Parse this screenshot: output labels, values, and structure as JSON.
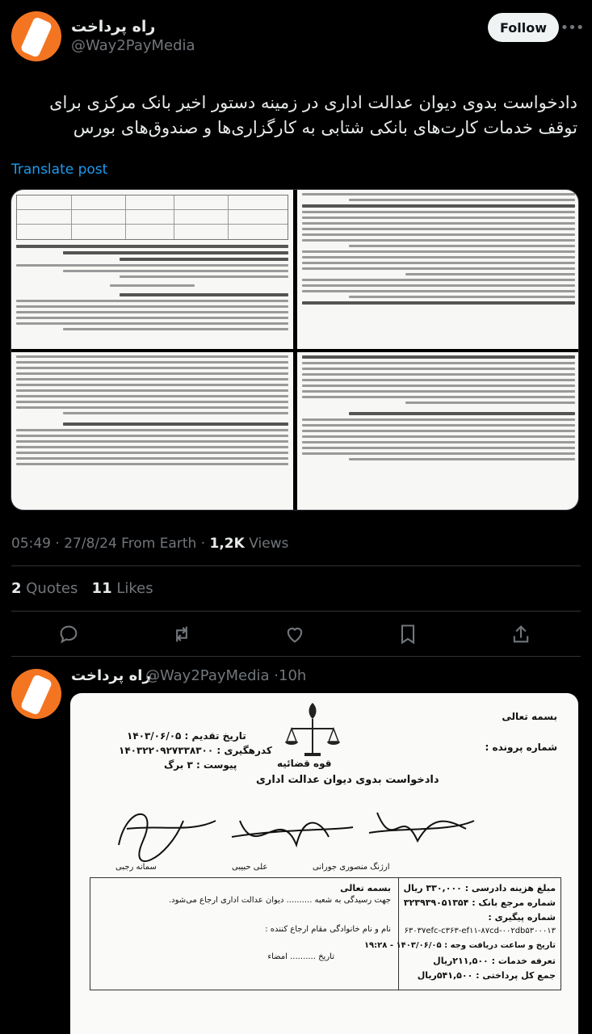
{
  "post": {
    "author_name": "راه پرداخت",
    "author_handle": "@Way2PayMedia",
    "follow_label": "Follow",
    "text": "دادخواست بدوی دیوان عدالت اداری در زمینه دستور اخیر بانک مرکزی برای توقف خدمات کارت‌های بانکی شتابی به کارگزاری‌ها و صندوق‌های بورس",
    "translate_label": "Translate post",
    "time": "05:49",
    "date": "27/8/24",
    "source": "From Earth",
    "views_count": "1,2K",
    "views_label": "Views",
    "quotes_count": "2",
    "quotes_label": "Quotes",
    "likes_count": "11",
    "likes_label": "Likes",
    "actions": [
      "reply-icon",
      "retweet-icon",
      "like-icon",
      "bookmark-icon",
      "share-icon"
    ]
  },
  "reply": {
    "author_name": "راه پرداخت",
    "author_handle": "@Way2PayMedia",
    "time_ago": "10h",
    "doc": {
      "basmala": "بسمه تعالی",
      "case_number_label": "شماره پرونده :",
      "submit_date": "تاریخ تقدیم : ۱۴۰۳/۰۶/۰۵",
      "tracking_code": "کدرهگیری : ۱۴۰۳۲۲۰۹۲۷۳۳۸۳۰۰",
      "attachment": "پیوست : ۳ برگ",
      "judiciary": "قوه قضائیه",
      "title": "دادخواست بدوی دیوان عدالت اداری",
      "signers": [
        "ارژنگ منصوری جورانی",
        "علی حبیبی",
        "سمانه رجبی"
      ],
      "fee_lines": [
        "مبلغ هزینه دادرسی : ۳۳۰,۰۰۰ ریال",
        "شماره مرجع بانک : ۳۲۳۹۳۹۰۵۱۳۵۴",
        "شماره پیگیری :",
        "۶۳۰۳۷efc-c۳۶۳-ef۱۱-۸۷cd-۰۰۲db۵۳۰۰۰۱۳",
        "تاریخ و ساعت دریافت وجه : ۱۴۰۳/۰۶/۰۵ - ۱۹:۲۸",
        "تعرفه خدمات : ۲۱۱,۵۰۰ریال",
        "جمع کل پرداختی : ۵۴۱,۵۰۰ریال"
      ],
      "referral": {
        "basmala": "بسمه تعالی",
        "line1": "جهت رسیدگی به شعبه .......... دیوان عدالت اداری ارجاع می‌شود.",
        "line2": "نام و نام خانوادگی مقام ارجاع کننده :",
        "line3": "تاریخ ..........      امضاء"
      }
    }
  }
}
